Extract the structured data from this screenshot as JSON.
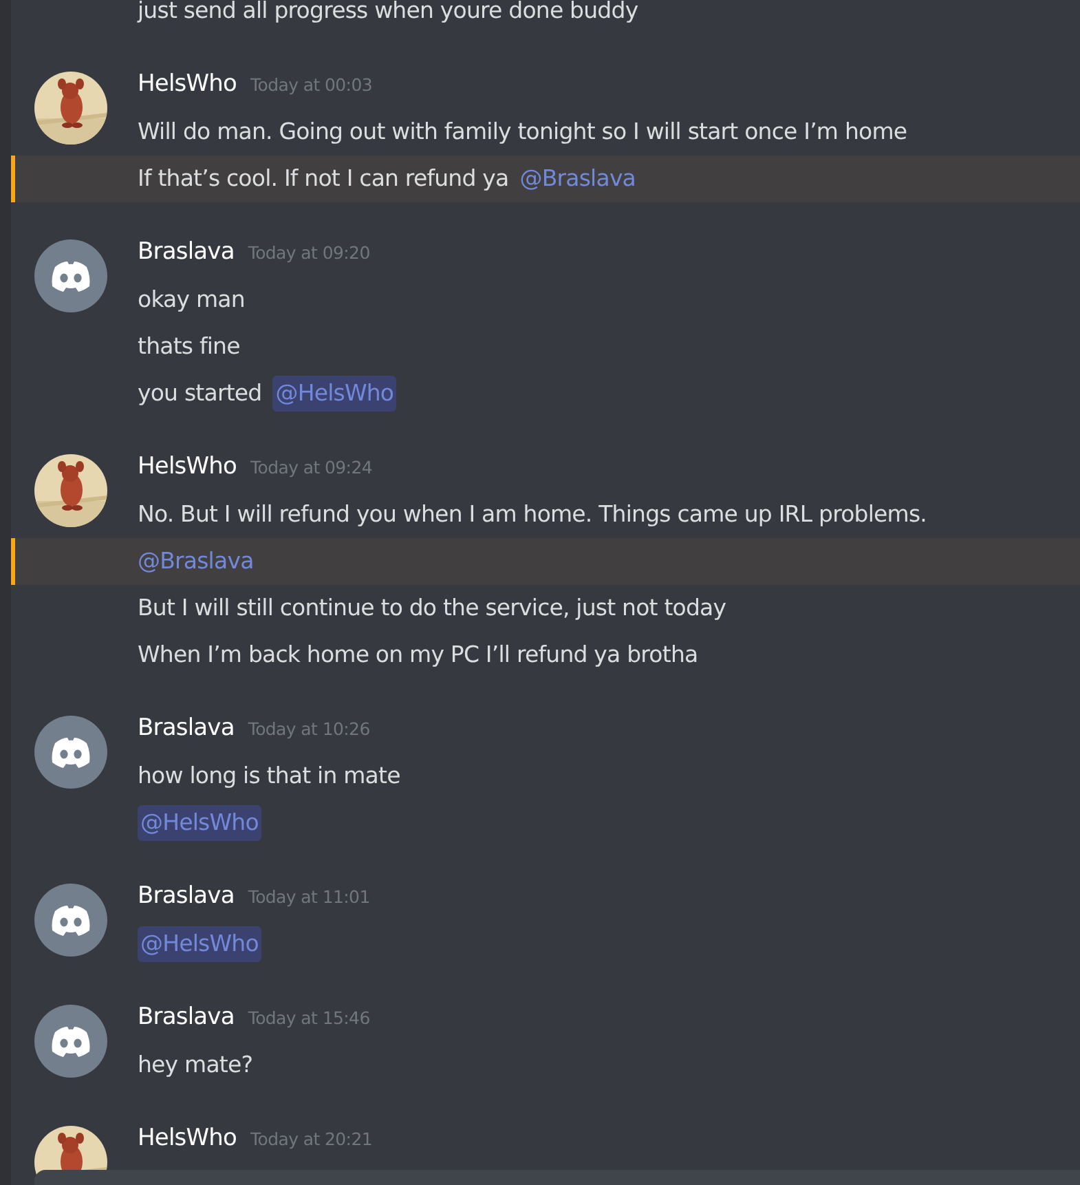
{
  "messages": [
    {
      "kind": "continuation",
      "lines": [
        {
          "text": "just send all progress when youre done buddy"
        }
      ]
    },
    {
      "kind": "message",
      "avatar": {
        "kind": "picture"
      },
      "author": "HelsWho",
      "time": "Today at 00:03",
      "lines": [
        {
          "text": "Will do man. Going out with family tonight so I will start once I’m home"
        },
        {
          "text": "If that’s cool. If not I can refund ya",
          "mention": "@Braslava",
          "highlighted": true
        }
      ]
    },
    {
      "kind": "message",
      "avatar": {
        "kind": "default"
      },
      "author": "Braslava",
      "time": "Today at 09:20",
      "lines": [
        {
          "text": "okay man"
        },
        {
          "text": "thats fine"
        },
        {
          "text": "you started",
          "mention": "@HelsWho"
        }
      ]
    },
    {
      "kind": "message",
      "avatar": {
        "kind": "picture"
      },
      "author": "HelsWho",
      "time": "Today at 09:24",
      "lines": [
        {
          "text": "No. But I will refund you when I am home. Things came up IRL problems."
        },
        {
          "mention": "@Braslava",
          "highlighted": true
        },
        {
          "text": "But I will still continue to do the service, just not today"
        },
        {
          "text": "When I’m back home on my PC I’ll refund ya brotha"
        }
      ]
    },
    {
      "kind": "message",
      "avatar": {
        "kind": "default"
      },
      "author": "Braslava",
      "time": "Today at 10:26",
      "lines": [
        {
          "text": "how long is that in mate"
        },
        {
          "mention": "@HelsWho"
        }
      ]
    },
    {
      "kind": "message",
      "avatar": {
        "kind": "default"
      },
      "author": "Braslava",
      "time": "Today at 11:01",
      "lines": [
        {
          "mention": "@HelsWho"
        }
      ]
    },
    {
      "kind": "message",
      "avatar": {
        "kind": "default"
      },
      "author": "Braslava",
      "time": "Today at 15:46",
      "lines": [
        {
          "text": "hey mate?"
        }
      ]
    },
    {
      "kind": "message",
      "avatar": {
        "kind": "picture"
      },
      "author": "HelsWho",
      "time": "Today at 20:21"
    }
  ]
}
